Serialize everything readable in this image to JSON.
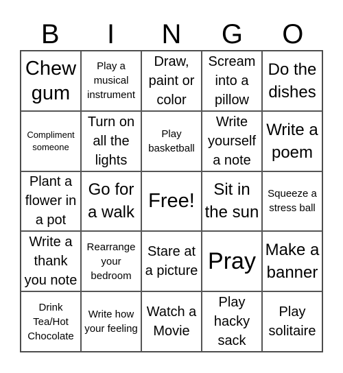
{
  "title_letters": [
    "B",
    "I",
    "N",
    "G",
    "O"
  ],
  "cells": [
    {
      "text": "Chew gum",
      "size": "xl"
    },
    {
      "text": "Play a musical instrument",
      "size": "sm"
    },
    {
      "text": "Draw, paint or color",
      "size": "md"
    },
    {
      "text": "Scream into a pillow",
      "size": "md"
    },
    {
      "text": "Do the dishes",
      "size": "lg"
    },
    {
      "text": "Compliment someone",
      "size": "xs"
    },
    {
      "text": "Turn on all the lights",
      "size": "md"
    },
    {
      "text": "Play basketball",
      "size": "sm"
    },
    {
      "text": "Write yourself a note",
      "size": "md"
    },
    {
      "text": "Write a poem",
      "size": "lg"
    },
    {
      "text": "Plant a flower in a pot",
      "size": "md"
    },
    {
      "text": "Go for a walk",
      "size": "lg"
    },
    {
      "text": "Free!",
      "size": "xl"
    },
    {
      "text": "Sit in the sun",
      "size": "lg"
    },
    {
      "text": "Squeeze a stress ball",
      "size": "sm"
    },
    {
      "text": "Write a thank you note",
      "size": "md"
    },
    {
      "text": "Rearrange your bedroom",
      "size": "sm"
    },
    {
      "text": "Stare at a picture",
      "size": "md"
    },
    {
      "text": "Pray",
      "size": "xxl"
    },
    {
      "text": "Make a banner",
      "size": "lg"
    },
    {
      "text": "Drink Tea/Hot Chocolate",
      "size": "sm"
    },
    {
      "text": "Write how your feeling",
      "size": "sm"
    },
    {
      "text": "Watch a Movie",
      "size": "md"
    },
    {
      "text": "Play hacky sack",
      "size": "md"
    },
    {
      "text": "Play solitaire",
      "size": "md"
    }
  ]
}
